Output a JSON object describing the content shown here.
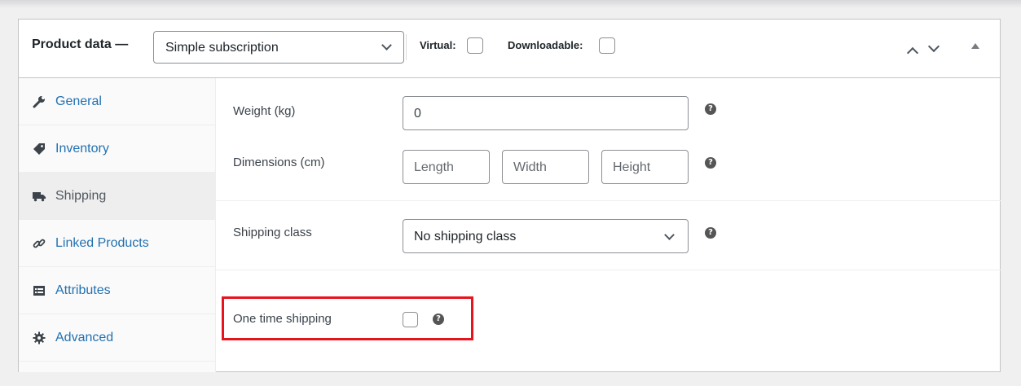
{
  "header": {
    "title": "Product data —",
    "product_type": "Simple subscription",
    "virtual_label": "Virtual:",
    "downloadable_label": "Downloadable:"
  },
  "sidebar": {
    "items": [
      {
        "label": "General",
        "icon": "wrench-icon"
      },
      {
        "label": "Inventory",
        "icon": "tag-icon"
      },
      {
        "label": "Shipping",
        "icon": "truck-icon",
        "active": true
      },
      {
        "label": "Linked Products",
        "icon": "link-icon"
      },
      {
        "label": "Attributes",
        "icon": "list-icon"
      },
      {
        "label": "Advanced",
        "icon": "gear-icon"
      }
    ]
  },
  "shipping": {
    "weight_label": "Weight (kg)",
    "weight_value": "0",
    "dimensions_label": "Dimensions (cm)",
    "length_placeholder": "Length",
    "width_placeholder": "Width",
    "height_placeholder": "Height",
    "shipping_class_label": "Shipping class",
    "shipping_class_value": "No shipping class",
    "one_time_label": "One time shipping"
  },
  "colors": {
    "link": "#2271b1",
    "highlight": "#e8141d",
    "active_tab": "#eeeeee"
  }
}
